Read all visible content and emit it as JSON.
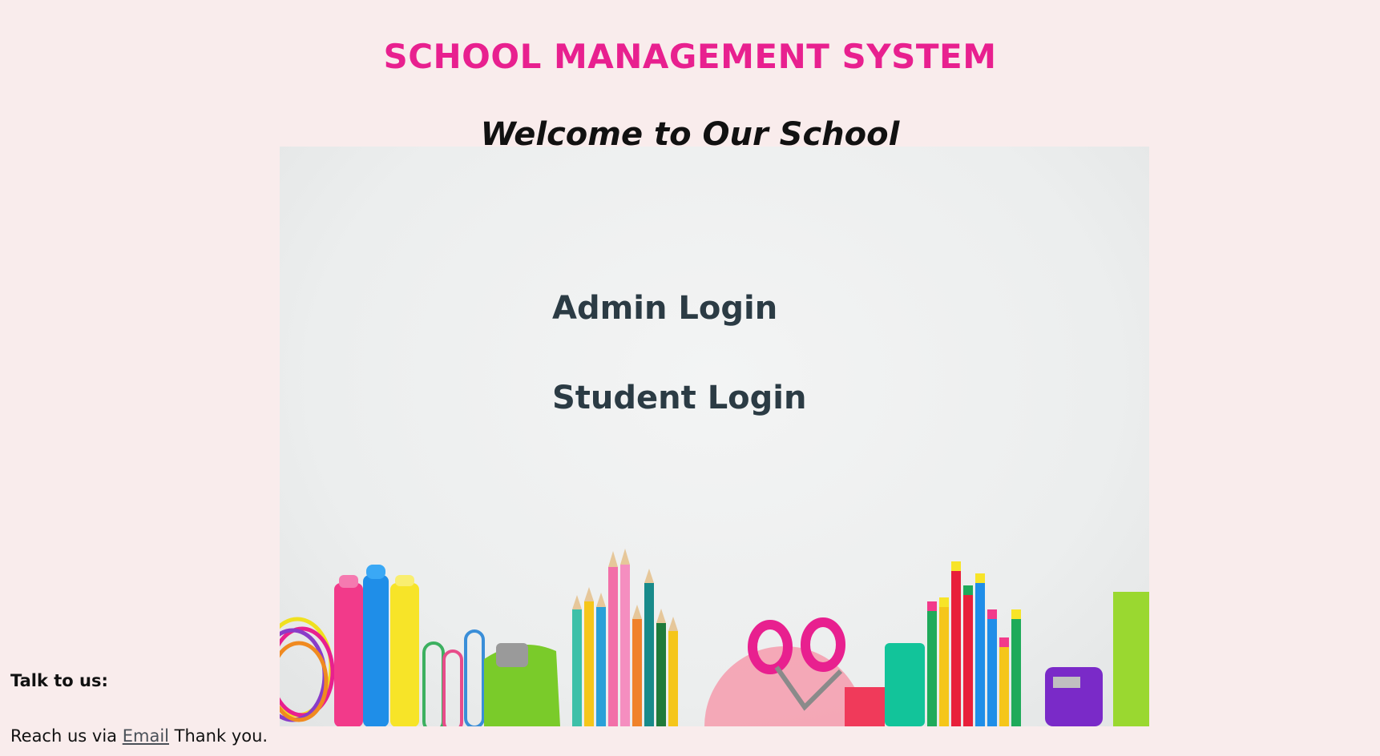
{
  "header": {
    "title": "SCHOOL MANAGEMENT SYSTEM",
    "welcome": "Welcome to Our School"
  },
  "hero": {
    "image": "school-supplies-illustration",
    "links": {
      "admin_login": "Admin Login",
      "student_login": "Student Login"
    }
  },
  "footer": {
    "talk_label": "Talk to us:",
    "reach_prefix": "Reach us via",
    "email_link": "Email",
    "reach_suffix": "Thank you."
  },
  "colors": {
    "background": "#f9ecec",
    "title": "#e8208f",
    "link": "#2b3b44"
  }
}
